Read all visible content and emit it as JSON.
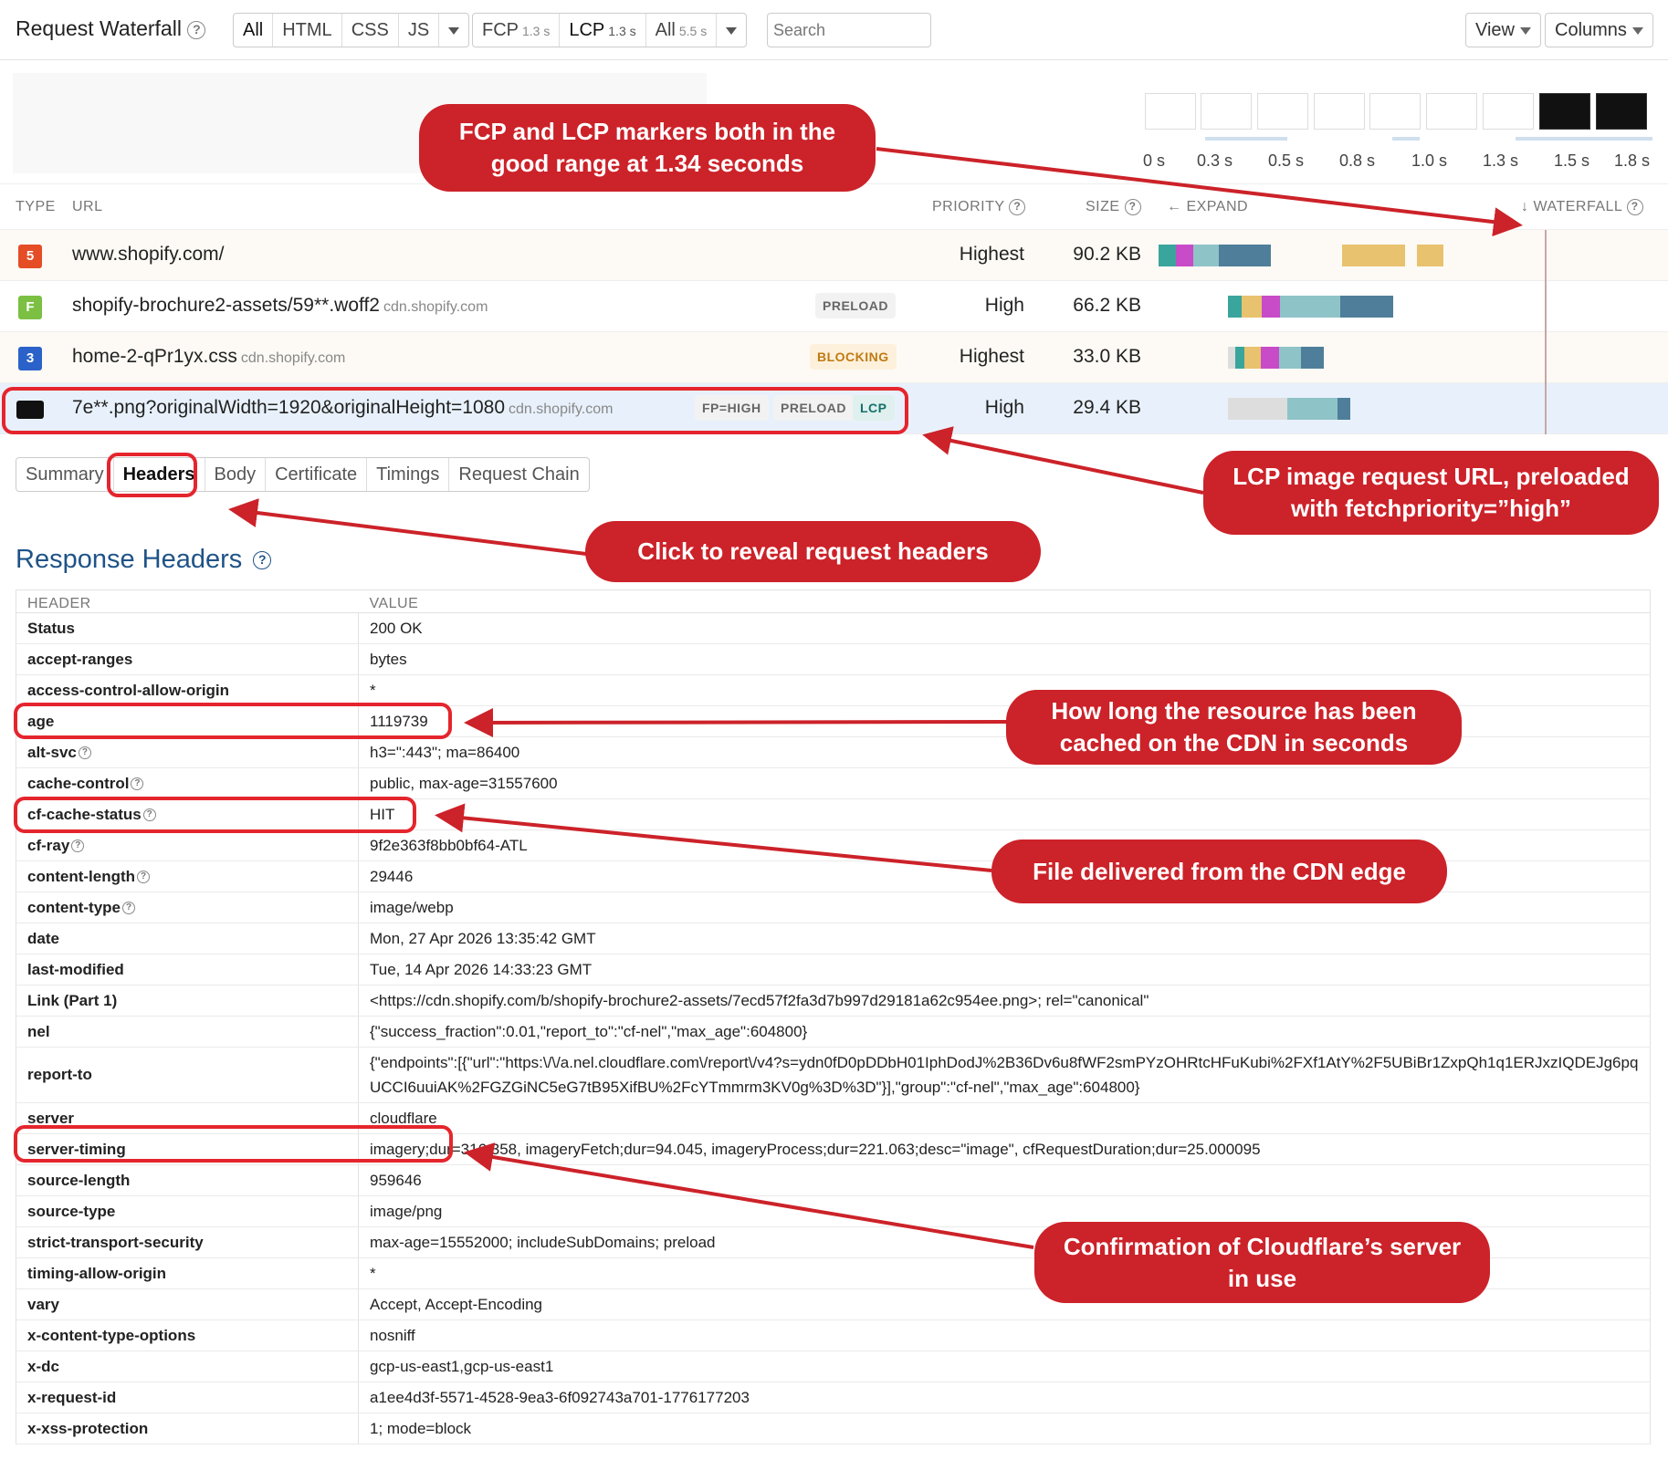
{
  "toolbar": {
    "title": "Request Waterfall",
    "type_filters": [
      "All",
      "HTML",
      "CSS",
      "JS"
    ],
    "milestones": [
      {
        "label": "FCP",
        "time": "1.3 s"
      },
      {
        "label": "LCP",
        "time": "1.3 s"
      },
      {
        "label": "All",
        "time": "5.5 s"
      }
    ],
    "search_placeholder": "Search",
    "view_label": "View",
    "columns_label": "Columns"
  },
  "timeline": {
    "ticks": [
      "0 s",
      "0.3 s",
      "0.5 s",
      "0.8 s",
      "1.0 s",
      "1.3 s",
      "1.5 s",
      "1.8 s"
    ]
  },
  "columns": {
    "type": "TYPE",
    "url": "URL",
    "priority": "PRIORITY",
    "size": "SIZE",
    "expand": "EXPAND",
    "waterfall": "WATERFALL"
  },
  "requests": [
    {
      "icon": "html5-icon",
      "icon_color": "#e44d26",
      "icon_glyph": "5",
      "url": "www.shopify.com/",
      "domain": "",
      "badges": [],
      "priority": "Highest",
      "size": "90.2 KB"
    },
    {
      "icon": "font-icon",
      "icon_color": "#7bc043",
      "icon_glyph": "F",
      "url": "shopify-brochure2-assets/59**.woff2",
      "domain": "cdn.shopify.com",
      "badges": [
        "PRELOAD"
      ],
      "priority": "High",
      "size": "66.2 KB"
    },
    {
      "icon": "css3-icon",
      "icon_color": "#2a62c9",
      "icon_glyph": "3",
      "url": "home-2-qPr1yx.css",
      "domain": "cdn.shopify.com",
      "badges": [
        "BLOCKING"
      ],
      "priority": "Highest",
      "size": "33.0 KB"
    },
    {
      "icon": "image-icon",
      "icon_color": "#111111",
      "icon_glyph": "",
      "url": "7e**.png?originalWidth=1920&originalHeight=1080",
      "domain": "cdn.shopify.com",
      "badges": [
        "FP=HIGH",
        "PRELOAD",
        "LCP"
      ],
      "priority": "High",
      "size": "29.4 KB"
    }
  ],
  "tabs": [
    "Summary",
    "Headers",
    "Body",
    "Certificate",
    "Timings",
    "Request Chain"
  ],
  "active_tab": "Headers",
  "response_headers": {
    "title": "Response Headers",
    "col_header": "HEADER",
    "col_value": "VALUE",
    "rows": [
      {
        "key": "Status",
        "value": "200 OK",
        "help": false
      },
      {
        "key": "accept-ranges",
        "value": "bytes",
        "help": false
      },
      {
        "key": "access-control-allow-origin",
        "value": "*",
        "help": false
      },
      {
        "key": "age",
        "value": "1119739",
        "help": false
      },
      {
        "key": "alt-svc",
        "value": "h3=\":443\"; ma=86400",
        "help": true
      },
      {
        "key": "cache-control",
        "value": "public, max-age=31557600",
        "help": true
      },
      {
        "key": "cf-cache-status",
        "value": "HIT",
        "help": true
      },
      {
        "key": "cf-ray",
        "value": "9f2e363f8bb0bf64-ATL",
        "help": true
      },
      {
        "key": "content-length",
        "value": "29446",
        "help": true
      },
      {
        "key": "content-type",
        "value": "image/webp",
        "help": true
      },
      {
        "key": "date",
        "value": "Mon, 27 Apr 2026 13:35:42 GMT",
        "help": false
      },
      {
        "key": "last-modified",
        "value": "Tue, 14 Apr 2026 14:33:23 GMT",
        "help": false
      },
      {
        "key": "Link (Part 1)",
        "value": "<https://cdn.shopify.com/b/shopify-brochure2-assets/7ecd57f2fa3d7b997d29181a62c954ee.png>; rel=\"canonical\"",
        "help": false
      },
      {
        "key": "nel",
        "value": "{\"success_fraction\":0.01,\"report_to\":\"cf-nel\",\"max_age\":604800}",
        "help": false
      },
      {
        "key": "report-to",
        "value": "{\"endpoints\":[{\"url\":\"https:\\/\\/a.nel.cloudflare.com\\/report\\/v4?s=ydn0fD0pDDbH01IphDodJ%2B36Dv6u8fWF2smPYzOHRtcHFuKubi%2FXf1AtY%2F5UBiBr1ZxpQh1q1ERJxzIQDEJg6pqUCCI6uuiAK%2FGZGiNC5eG7tB95XifBU%2FcYTmmrm3KV0g%3D%3D\"}],\"group\":\"cf-nel\",\"max_age\":604800}",
        "help": false
      },
      {
        "key": "server",
        "value": "cloudflare",
        "help": false
      },
      {
        "key": "server-timing",
        "value": "imagery;dur=316.358, imageryFetch;dur=94.045, imageryProcess;dur=221.063;desc=\"image\", cfRequestDuration;dur=25.000095",
        "help": false
      },
      {
        "key": "source-length",
        "value": "959646",
        "help": false
      },
      {
        "key": "source-type",
        "value": "image/png",
        "help": false
      },
      {
        "key": "strict-transport-security",
        "value": "max-age=15552000; includeSubDomains; preload",
        "help": false
      },
      {
        "key": "timing-allow-origin",
        "value": "*",
        "help": false
      },
      {
        "key": "vary",
        "value": "Accept, Accept-Encoding",
        "help": false
      },
      {
        "key": "x-content-type-options",
        "value": "nosniff",
        "help": false
      },
      {
        "key": "x-dc",
        "value": "gcp-us-east1,gcp-us-east1",
        "help": false
      },
      {
        "key": "x-request-id",
        "value": "a1ee4d3f-5571-4528-9ea3-6f092743a701-1776177203",
        "help": false
      },
      {
        "key": "x-xss-protection",
        "value": "1; mode=block",
        "help": false
      }
    ]
  },
  "callouts": {
    "fcp_lcp": "FCP and LCP markers both in the good range at 1.34 seconds",
    "lcp_image": "LCP image request URL, preloaded with fetchpriority=”high”",
    "headers_tab": "Click to reveal request headers",
    "age": "How long the resource has been cached on the CDN in seconds",
    "cache_status": "File delivered from the CDN edge",
    "server": "Confirmation of Cloudflare’s server in use"
  },
  "colors": {
    "callout": "#cc2229",
    "highlight": "#e5252d",
    "title_blue": "#1f5387",
    "bar_teal": "#8ec3c8",
    "bar_steel": "#4f7e9a",
    "bar_magenta": "#c84bc8",
    "bar_orange": "#e8c26e"
  }
}
